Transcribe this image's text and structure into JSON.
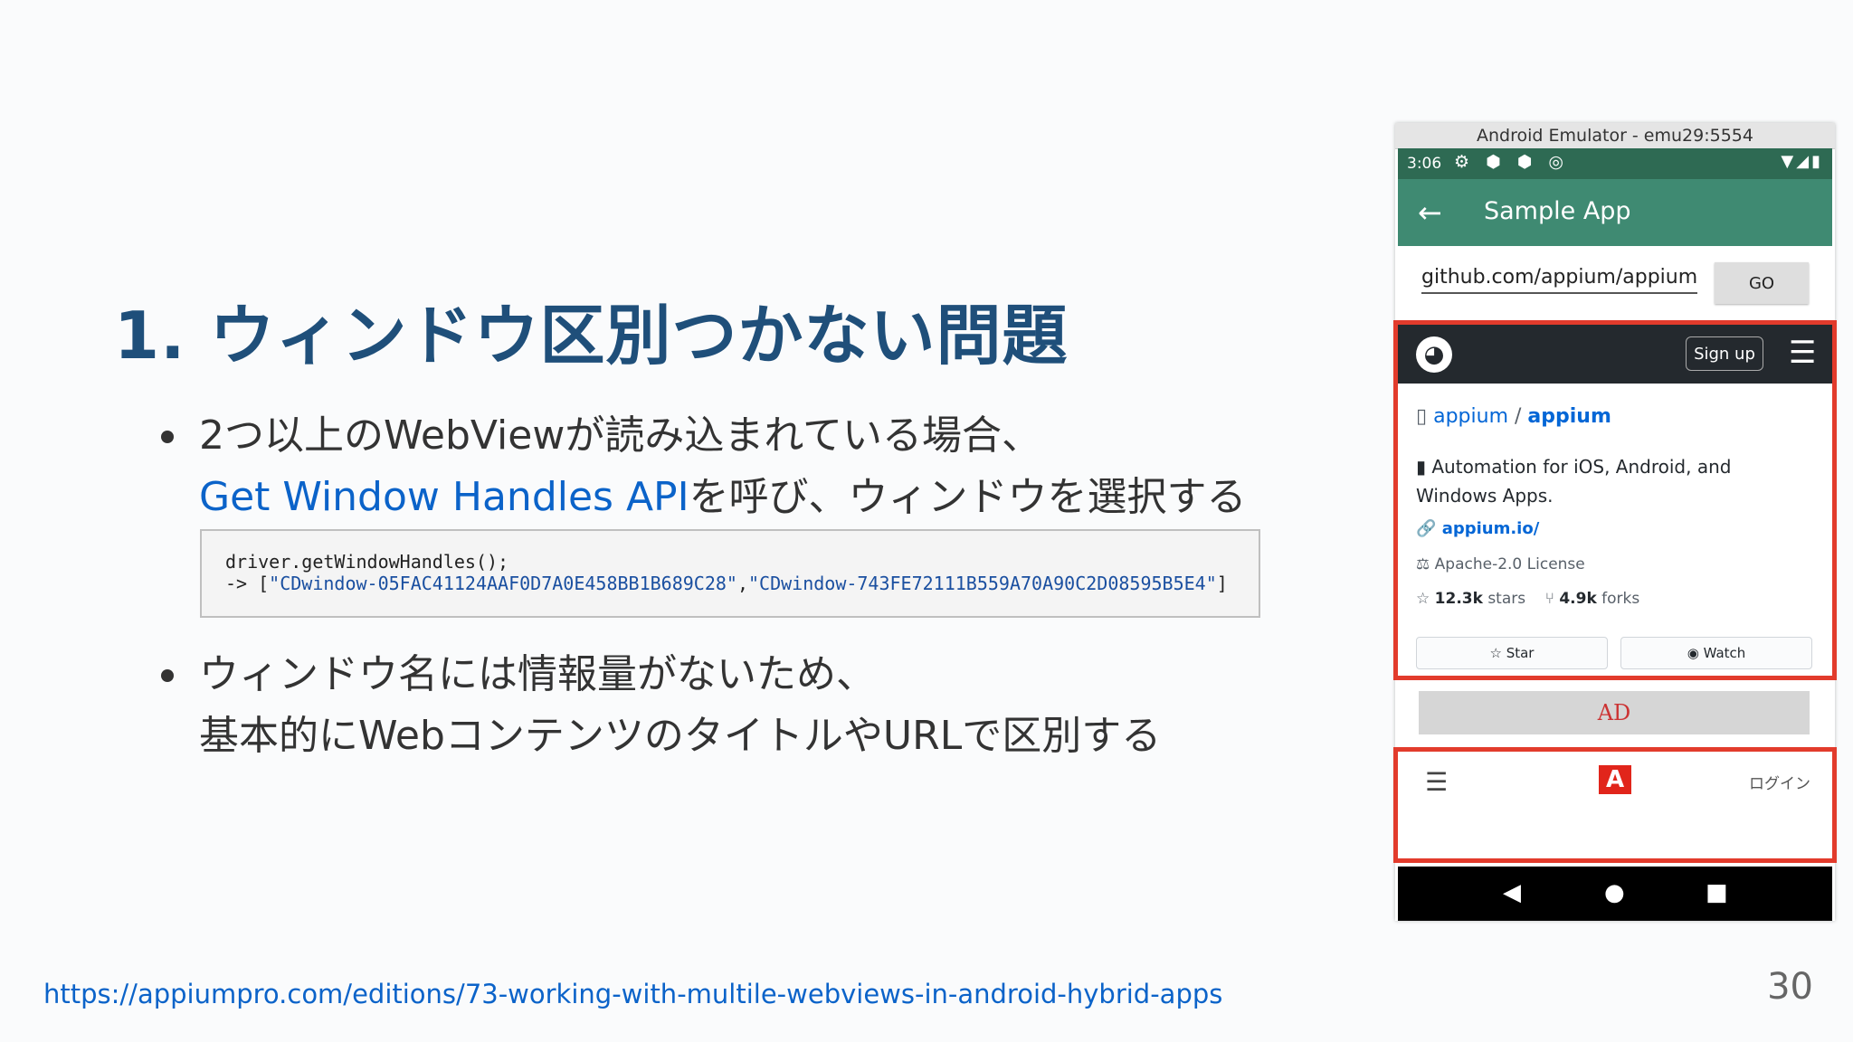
{
  "slide": {
    "title": "1. ウィンドウ区別つかない問題",
    "bullet1_line1": "2つ以上のWebViewが読み込まれている場合、",
    "bullet1_link": "Get Window Handles API",
    "bullet1_line2_rest": "を呼び、ウィンドウを選択する",
    "code_line1": "driver.getWindowHandles();",
    "code_line2_prefix": "-> [",
    "code_line2_str1": "\"CDwindow-05FAC41124AAF0D7A0E458BB1B689C28\"",
    "code_line2_sep": ",",
    "code_line2_str2": "\"CDwindow-743FE72111B559A70A90C2D08595B5E4\"",
    "code_line2_suffix": "]",
    "bullet2_line1": "ウィンドウ名には情報量がないため、",
    "bullet2_line2": "基本的にWebコンテンツのタイトルやURLで区別する",
    "footer_url": "https://appiumpro.com/editions/73-working-with-multile-webviews-in-android-hybrid-apps",
    "page_number": "30"
  },
  "emulator": {
    "window_title": "Android Emulator - emu29:5554",
    "status_time": "3:06",
    "status_icons": "⚙ ⬢ ⬢ ◎",
    "status_right": "▼◢▮",
    "app_title": "Sample App",
    "back_glyph": "←",
    "url_value": "github.com/appium/appium",
    "go_label": "GO",
    "github": {
      "logo_glyph": "◕",
      "signup_label": "Sign up",
      "menu_glyph": "☰",
      "repo_owner": "appium",
      "repo_sep": " / ",
      "repo_name": "appium",
      "description": "Automation for iOS, Android, and Windows Apps.",
      "website": "appium.io/",
      "license": "Apache-2.0 License",
      "stars": "12.3k",
      "stars_label": "stars",
      "forks": "4.9k",
      "forks_label": "forks",
      "star_button": "☆ Star",
      "watch_button": "◉ Watch"
    },
    "ad_label": "AD",
    "adobe": {
      "menu_glyph": "☰",
      "logo_glyph": "A",
      "login_label": "ログイン"
    },
    "nav": {
      "back": "◀",
      "home": "●",
      "recents": "■"
    }
  }
}
